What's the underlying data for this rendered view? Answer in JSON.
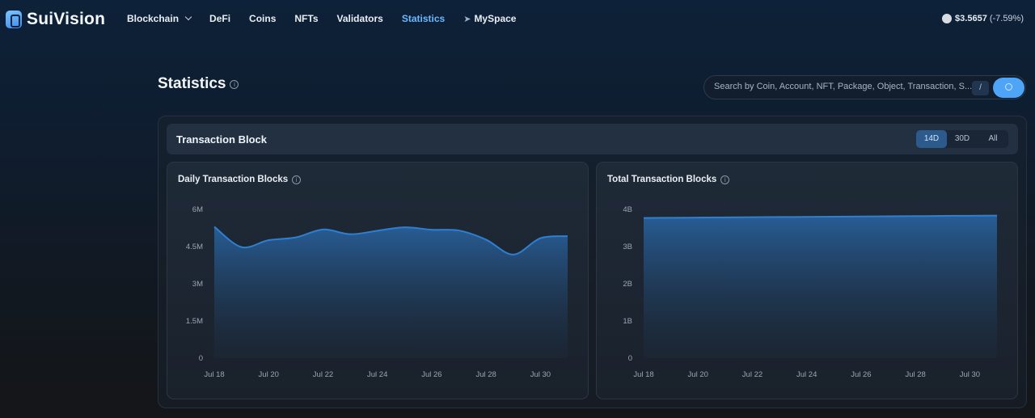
{
  "nav": {
    "logo": "SuiVision",
    "items": [
      {
        "label": "Blockchain",
        "dropdown": true
      },
      {
        "label": "DeFi"
      },
      {
        "label": "Coins"
      },
      {
        "label": "NFTs"
      },
      {
        "label": "Validators"
      },
      {
        "label": "Statistics",
        "active": true
      },
      {
        "label": "MySpace"
      }
    ],
    "price": "$3.5657",
    "price_change": "(-7.59%)"
  },
  "page": {
    "title": "Statistics",
    "search_placeholder": "Search by Coin, Account, NFT, Package, Object, Transaction, S...",
    "search_shortcut": "/"
  },
  "panel": {
    "title": "Transaction Block",
    "ranges": [
      "14D",
      "30D",
      "All"
    ],
    "active_range": "14D"
  },
  "colors": {
    "accent": "#4ea4f7",
    "line": "#2f7fd0"
  },
  "chart_data": [
    {
      "type": "area",
      "title": "Daily Transaction Blocks",
      "x": [
        "Jul 18",
        "Jul 19",
        "Jul 20",
        "Jul 21",
        "Jul 22",
        "Jul 23",
        "Jul 24",
        "Jul 25",
        "Jul 26",
        "Jul 27",
        "Jul 28",
        "Jul 29",
        "Jul 30",
        "Jul 31"
      ],
      "x_tick_labels": [
        "Jul 18",
        "Jul 20",
        "Jul 22",
        "Jul 24",
        "Jul 26",
        "Jul 28",
        "Jul 30"
      ],
      "series": [
        {
          "values": [
            5.3,
            4.48,
            4.76,
            4.87,
            5.19,
            5.0,
            5.14,
            5.28,
            5.18,
            5.15,
            4.78,
            4.18,
            4.84,
            4.92
          ]
        }
      ],
      "y_unit": "M",
      "y_ticks": [
        "0",
        "1.5M",
        "3M",
        "4.5M",
        "6M"
      ],
      "ylim": [
        0,
        6
      ],
      "grid": false
    },
    {
      "type": "area",
      "title": "Total Transaction Blocks",
      "x": [
        "Jul 18",
        "Jul 19",
        "Jul 20",
        "Jul 21",
        "Jul 22",
        "Jul 23",
        "Jul 24",
        "Jul 25",
        "Jul 26",
        "Jul 27",
        "Jul 28",
        "Jul 29",
        "Jul 30",
        "Jul 31"
      ],
      "x_tick_labels": [
        "Jul 18",
        "Jul 20",
        "Jul 22",
        "Jul 24",
        "Jul 26",
        "Jul 28",
        "Jul 30"
      ],
      "series": [
        {
          "values": [
            3.77,
            3.775,
            3.78,
            3.785,
            3.79,
            3.795,
            3.8,
            3.805,
            3.81,
            3.815,
            3.82,
            3.825,
            3.83,
            3.835
          ]
        }
      ],
      "y_unit": "B",
      "y_ticks": [
        "0",
        "1B",
        "2B",
        "3B",
        "4B"
      ],
      "ylim": [
        0,
        4
      ],
      "grid": false
    }
  ]
}
